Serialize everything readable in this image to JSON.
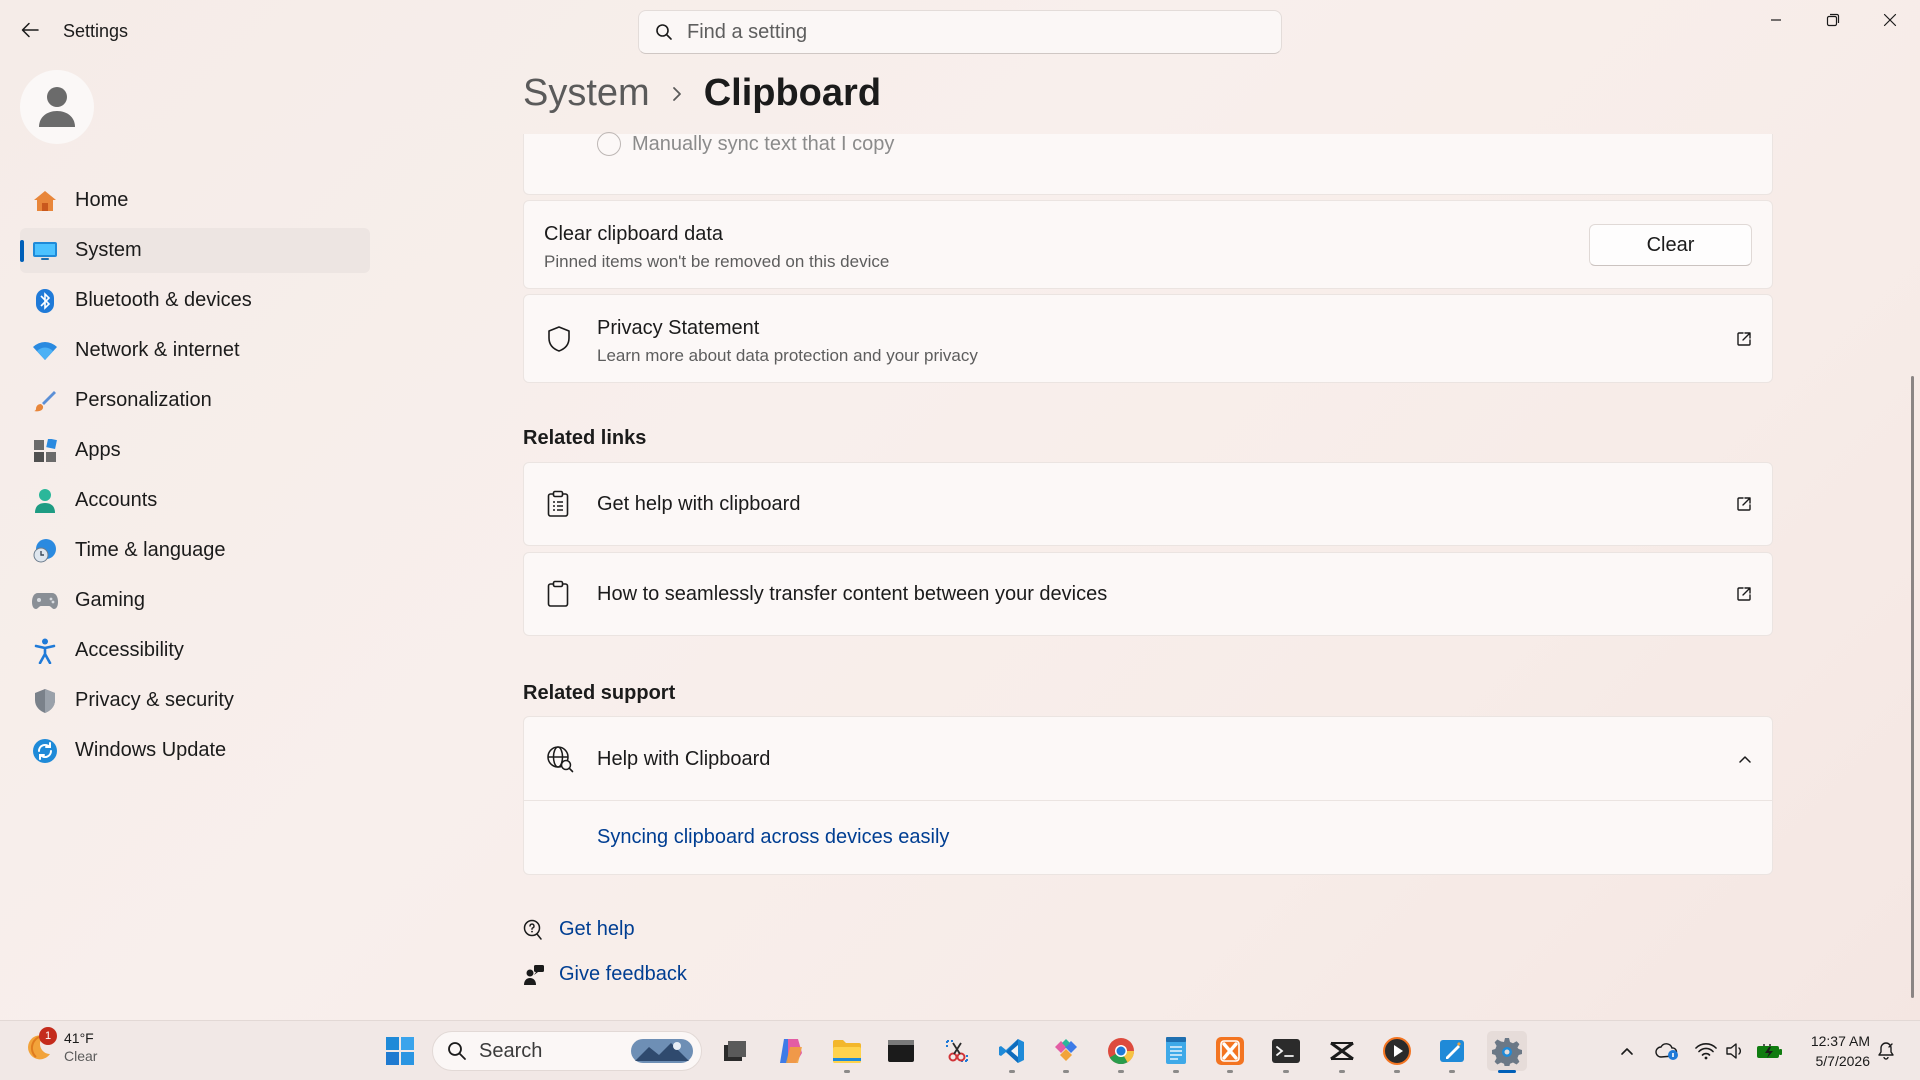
{
  "window": {
    "title": "Settings"
  },
  "search": {
    "placeholder": "Find a setting"
  },
  "sidebar": {
    "items": [
      {
        "label": "Home",
        "icon": "home-icon"
      },
      {
        "label": "System",
        "icon": "system-icon",
        "active": true
      },
      {
        "label": "Bluetooth & devices",
        "icon": "bluetooth-icon"
      },
      {
        "label": "Network & internet",
        "icon": "wifi-icon"
      },
      {
        "label": "Personalization",
        "icon": "brush-icon"
      },
      {
        "label": "Apps",
        "icon": "apps-icon"
      },
      {
        "label": "Accounts",
        "icon": "person-icon"
      },
      {
        "label": "Time & language",
        "icon": "globe-clock-icon"
      },
      {
        "label": "Gaming",
        "icon": "gamepad-icon"
      },
      {
        "label": "Accessibility",
        "icon": "accessibility-icon"
      },
      {
        "label": "Privacy & security",
        "icon": "shield-icon"
      },
      {
        "label": "Windows Update",
        "icon": "update-icon"
      }
    ]
  },
  "breadcrumb": {
    "parent": "System",
    "current": "Clipboard"
  },
  "sync": {
    "option_label": "Manually sync text that I copy"
  },
  "clear_data": {
    "title": "Clear clipboard data",
    "subtitle": "Pinned items won't be removed on this device",
    "button": "Clear"
  },
  "privacy": {
    "title": "Privacy Statement",
    "subtitle": "Learn more about data protection and your privacy"
  },
  "related_links": {
    "heading": "Related links",
    "items": [
      {
        "label": "Get help with clipboard"
      },
      {
        "label": "How to seamlessly transfer content between your devices"
      }
    ]
  },
  "related_support": {
    "heading": "Related support",
    "title": "Help with Clipboard",
    "link": "Syncing clipboard across devices easily"
  },
  "footer": {
    "get_help": "Get help",
    "give_feedback": "Give feedback"
  },
  "taskbar": {
    "weather": {
      "temp": "41°F",
      "condition": "Clear",
      "badge": "1"
    },
    "search_label": "Search",
    "time": "12:37 AM",
    "date": "5/7/2026"
  },
  "colors": {
    "accent": "#005fb8",
    "link": "#003e92"
  }
}
